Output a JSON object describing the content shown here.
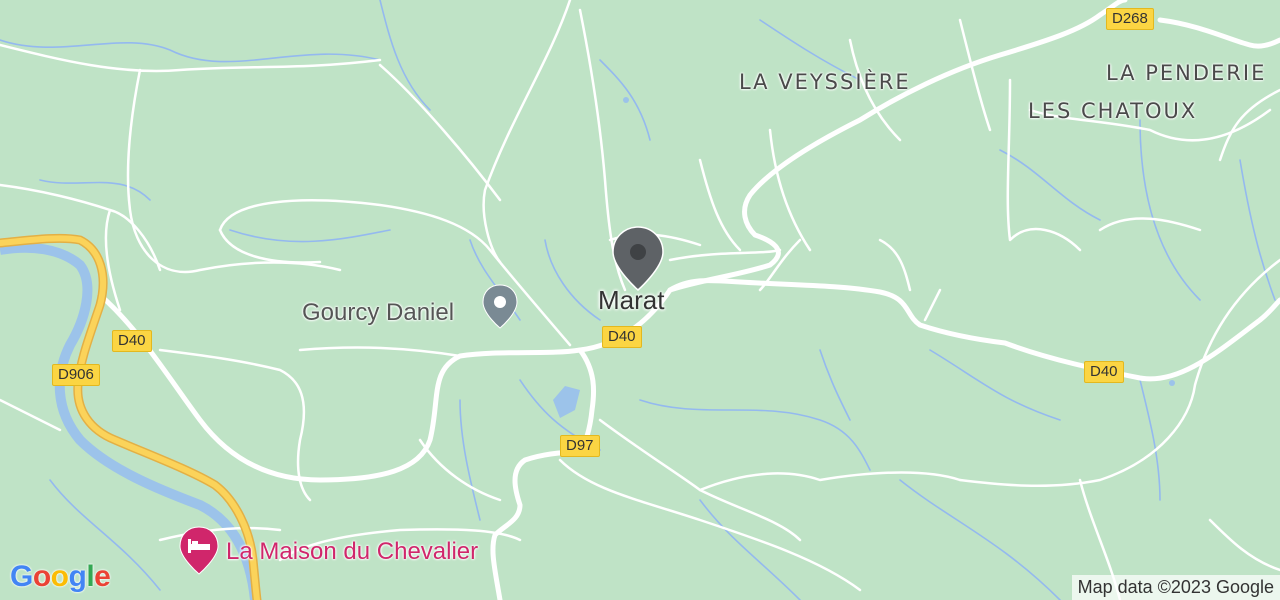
{
  "map": {
    "town": "Marat",
    "places": {
      "la_veyssiere": "LA VEYSSIÈRE",
      "la_penderie": "LA PENDERIE",
      "les_chatoux": "LES CHATOUX"
    },
    "pois": {
      "gourcy": "Gourcy Daniel",
      "hotel": "La Maison du Chevalier"
    },
    "roads": {
      "d268": "D268",
      "d40_west": "D40",
      "d40_center": "D40",
      "d40_east": "D40",
      "d906": "D906",
      "d97": "D97"
    },
    "attribution": "Map data ©2023 Google",
    "logo": {
      "text": "Google",
      "colors": [
        "#4285F4",
        "#EA4335",
        "#FBBC05",
        "#4285F4",
        "#34A853",
        "#EA4335"
      ]
    },
    "icons": {
      "town_pin": "map-marker-icon",
      "gourcy_pin": "map-marker-icon",
      "hotel": "bed-icon"
    },
    "colors": {
      "land": "#bfe3c6",
      "road": "#ffffff",
      "highway": "#f6c141",
      "water": "#9cc3ea",
      "hotel": "#d0266b"
    }
  }
}
